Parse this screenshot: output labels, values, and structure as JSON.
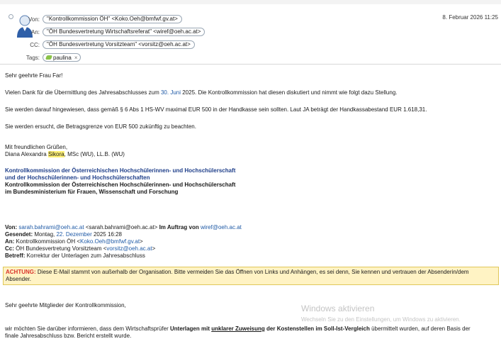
{
  "header": {
    "from_label": "Von:",
    "from_value": "\"Kontrollkommission ÖH\" <Koko.Oeh@bmfwf.gv.at>",
    "to_label": "An:",
    "to_value": "\"ÖH Bundesvertretung Wirtschaftsreferat\" <wiref@oeh.ac.at>",
    "cc_label": "CC:",
    "cc_value": "\"ÖH Bundesvertretung Vorsitzteam\" <vorsitz@oeh.ac.at>",
    "tags_label": "Tags:",
    "tag_value": "paulina",
    "tag_close": "×",
    "date": "8. Februar 2026 11:25"
  },
  "body": {
    "greeting": "Sehr geehrte Frau Far!",
    "p1_a": "Vielen Dank für die Übermittlung des Jahresabschlusses zum ",
    "p1_date": "30. Juni",
    "p1_b": " 2025. Die Kontrollkommission hat diesen diskutiert und nimmt wie folgt dazu Stellung.",
    "p2": "Sie werden darauf hingewiesen, dass gemäß § 6 Abs 1 HS-WV maximal EUR 500 in der Handkasse sein sollten. Laut JA beträgt der Handkassabestand EUR 1.618,31.",
    "p3": "Sie werden ersucht, die Betragsgrenze von EUR 500 zukünftig zu beachten.",
    "closing": "Mit freundlichen Grüßen,",
    "sig_name_a": "Diana Alexandra ",
    "sig_name_hl": "Sikora",
    "sig_name_b": ", MSc (WU), LL.B. (WU)",
    "org_line1": "Kontrollkommission der Österreichischen Hochschülerinnen- und Hochschülerschaft",
    "org_line2": "und der Hochschülerinnen- und Hochschülerschaften",
    "org_line3": "Kontrollkommission der Österreichischen Hochschülerinnen- und Hochschülerschaft",
    "org_line4": "im Bundesministerium für Frauen, Wissenschaft und Forschung"
  },
  "quoted": {
    "von_label": "Von:",
    "von_email": "sarah.bahrami@oeh.ac.at",
    "von_email2": "<sarah.bahrami@oeh.ac.at>",
    "von_auftrag": " Im Auftrag von ",
    "von_auftrag_email": "wiref@oeh.ac.at",
    "gesendet_label": "Gesendet:",
    "gesendet_a": " Montag, ",
    "gesendet_date": "22. Dezember",
    "gesendet_b": " 2025 16:28",
    "an_label": "An:",
    "an_a": " Kontrollkommission ÖH <",
    "an_email": "Koko.Oeh@bmfwf.gv.at",
    "an_b": ">",
    "cc_label": "Cc:",
    "cc_a": " ÖH Bundesvertretung Vorsitzteam <",
    "cc_email": "vorsitz@oeh.ac.at",
    "cc_b": ">",
    "betreff_label": "Betreff:",
    "betreff_value": " Korrektur der Unterlagen zum Jahresabschluss"
  },
  "warning": {
    "label": "ACHTUNG:",
    "text": " Diese E-Mail stammt von außerhalb der Organisation. Bitte vermeiden Sie das Öffnen von Links und Anhängen, es sei denn, Sie kennen und vertrauen der Absenderin/dem Absender."
  },
  "quoted_body": {
    "greeting": "Sehr geehrte Mitglieder der Kontrollkommission,",
    "p1_a": "wir möchten Sie darüber informieren, dass dem Wirtschaftsprüfer ",
    "p1_bold1": "Unterlagen mit ",
    "p1_ul": "unklarer Zuweisung",
    "p1_bold2": " der Kostenstellen im Soll-Ist-Vergleich",
    "p1_b": "  übermittelt wurden, auf deren Basis der",
    "p1_c": "finale Jahresabschluss bzw. Bericht erstellt wurde."
  },
  "watermark": {
    "title": "Windows aktivieren",
    "subtitle": "Wechseln Sie zu den Einstellungen, um Windows zu aktivieren."
  },
  "colors": {
    "link": "#1f5aa6",
    "org": "#1f3f8a",
    "warning_bg": "#fff3c4",
    "warning_label": "#d9342b",
    "highlight": "#fff176"
  }
}
